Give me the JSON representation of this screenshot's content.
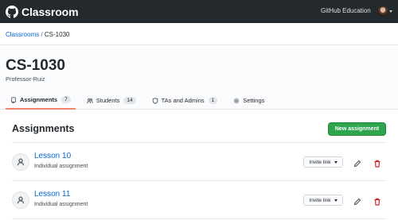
{
  "app": {
    "brand": "Classroom",
    "org_link": "GitHub Education"
  },
  "breadcrumb": {
    "parent": "Classrooms",
    "separator": " / ",
    "current": "CS-1030"
  },
  "classroom": {
    "title": "CS-1030",
    "owner": "Professor-Ruiz"
  },
  "tabs": [
    {
      "label": "Assignments",
      "count": "7",
      "icon": "repo-icon",
      "active": true
    },
    {
      "label": "Students",
      "count": "14",
      "icon": "people-icon",
      "active": false
    },
    {
      "label": "TAs and Admins",
      "count": "1",
      "icon": "shield-icon",
      "active": false
    },
    {
      "label": "Settings",
      "count": "",
      "icon": "gear-icon",
      "active": false
    }
  ],
  "assignments": {
    "heading": "Assignments",
    "new_button": "New assignment",
    "items": [
      {
        "title": "Lesson 10",
        "type": "Individual assignment",
        "invite_label": "Invite link"
      },
      {
        "title": "Lesson 11",
        "type": "Individual assignment",
        "invite_label": "Invite link"
      }
    ]
  },
  "colors": {
    "topbar": "#24292e",
    "link": "#0366d6",
    "primary_button": "#2ea44f",
    "active_tab": "#f9826c",
    "danger": "#cb2431"
  }
}
